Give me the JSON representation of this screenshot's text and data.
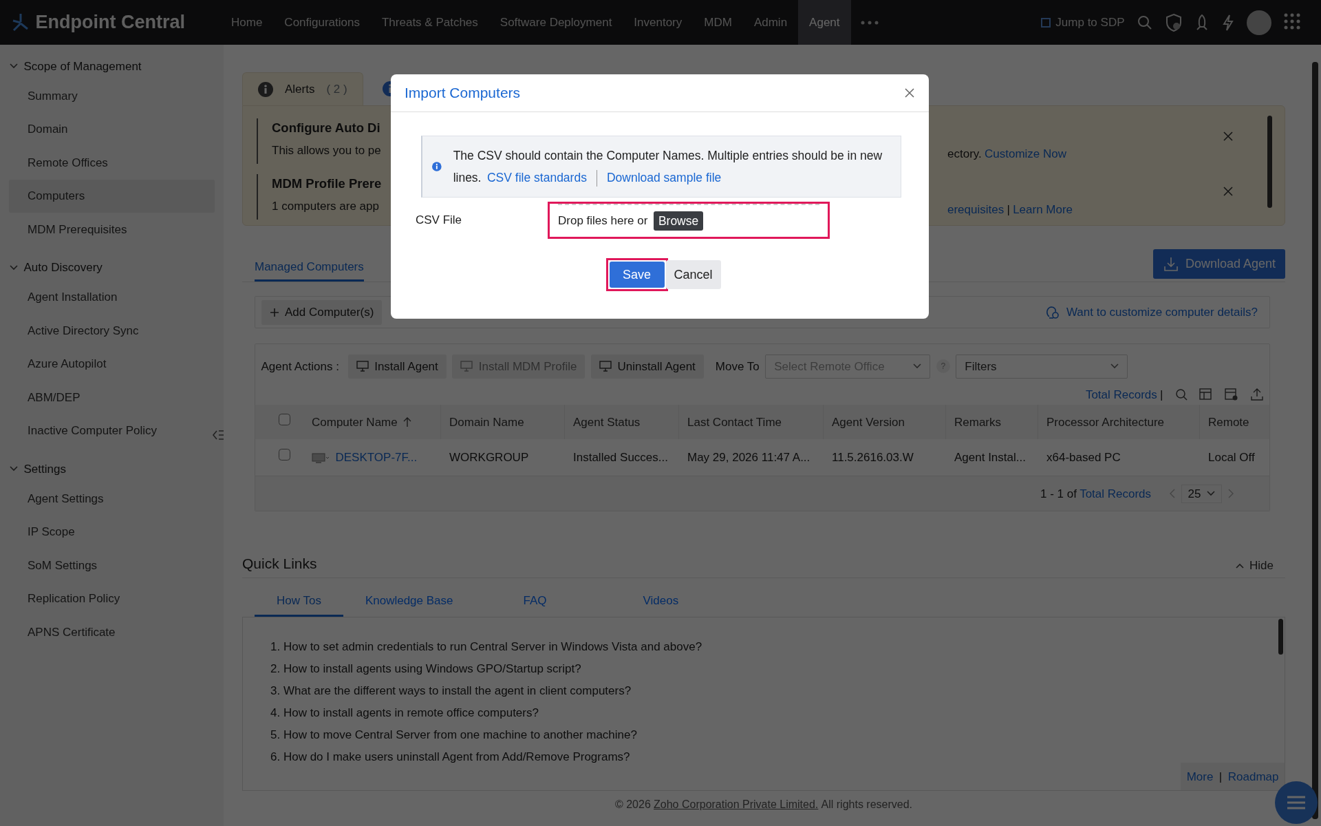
{
  "app": {
    "title": "Endpoint Central"
  },
  "nav": [
    {
      "label": "Home",
      "selected": false
    },
    {
      "label": "Configurations",
      "selected": false
    },
    {
      "label": "Threats & Patches",
      "selected": false
    },
    {
      "label": "Software Deployment",
      "selected": false
    },
    {
      "label": "Inventory",
      "selected": false
    },
    {
      "label": "MDM",
      "selected": false
    },
    {
      "label": "Admin",
      "selected": false
    },
    {
      "label": "Agent",
      "selected": true
    }
  ],
  "jump": "Jump to SDP",
  "sidebar": [
    {
      "label": "Scope of Management",
      "expanded": true,
      "children": [
        {
          "label": "Summary",
          "selected": false
        },
        {
          "label": "Domain",
          "selected": false
        },
        {
          "label": "Remote Offices",
          "selected": false
        },
        {
          "label": "Computers",
          "selected": true
        },
        {
          "label": "MDM Prerequisites",
          "selected": false
        }
      ]
    },
    {
      "label": "Auto Discovery",
      "expanded": true,
      "children": [
        {
          "label": "Agent Installation",
          "selected": false
        },
        {
          "label": "Active Directory Sync",
          "selected": false
        },
        {
          "label": "Azure Autopilot",
          "selected": false
        },
        {
          "label": "ABM/DEP",
          "selected": false
        },
        {
          "label": "Inactive Computer Policy",
          "selected": false
        }
      ]
    },
    {
      "label": "Settings",
      "expanded": true,
      "children": [
        {
          "label": "Agent Settings",
          "selected": false
        },
        {
          "label": "IP Scope",
          "selected": false
        },
        {
          "label": "SoM Settings",
          "selected": false
        },
        {
          "label": "Replication Policy",
          "selected": false
        },
        {
          "label": "APNS Certificate",
          "selected": false
        }
      ]
    }
  ],
  "alert_tabs": [
    {
      "label": "Alerts",
      "count": "( 2 )",
      "selected": true
    }
  ],
  "alerts": [
    {
      "title": "Configure Auto Di",
      "text": "This allows you to pe",
      "tail": "ectory.",
      "links": [
        "Customize Now"
      ]
    },
    {
      "title": "MDM Profile Prere",
      "text": "1 computers are app",
      "links": [
        "erequisites",
        "Learn More"
      ],
      "separator": "|"
    }
  ],
  "content_tabs": [
    {
      "label": "Managed Computers",
      "selected": true
    }
  ],
  "download_button": "Download Agent",
  "add_button": "Add Computer(s)",
  "customize_link": "Want to customize computer details?",
  "agent_actions": {
    "label": "Agent Actions :",
    "buttons": [
      {
        "label": "Install Agent",
        "disabled": false
      },
      {
        "label": "Install MDM Profile",
        "disabled": true
      },
      {
        "label": "Uninstall Agent",
        "disabled": false
      }
    ],
    "move_to": "Move To",
    "remote_office": {
      "placeholder": "Select Remote Office"
    },
    "help": "?",
    "filters": "Filters"
  },
  "total_records_link": "Total Records",
  "total_records_separator": "|",
  "table": {
    "select_all_checked": false,
    "columns": [
      "Computer Name",
      "Domain Name",
      "Agent Status",
      "Last Contact Time",
      "Agent Version",
      "Remarks",
      "Processor Architecture",
      "Remote"
    ],
    "rows": [
      {
        "checked": false,
        "cells": [
          "DESKTOP-7F...",
          "WORKGROUP",
          "Installed Succes...",
          "May 29, 2026 11:47 A...",
          "11.5.2616.03.W",
          "Agent Instal...",
          "x64-based PC",
          "Local Off"
        ]
      }
    ]
  },
  "pagination": {
    "range": "1 - 1 of",
    "link": "Total Records",
    "page_size": "25"
  },
  "quick_links": {
    "title": "Quick Links",
    "hide": "Hide",
    "tabs": [
      {
        "label": "How Tos",
        "selected": true
      },
      {
        "label": "Knowledge Base",
        "selected": false
      },
      {
        "label": "FAQ",
        "selected": false
      },
      {
        "label": "Videos",
        "selected": false
      }
    ],
    "items": [
      "1. How to set admin credentials to run Central Server in Windows Vista and above?",
      "2. How to install agents using Windows GPO/Startup script?",
      "3. What are the different ways to install the agent in client computers?",
      "4. How to install agents in remote office computers?",
      "5. How to move Central Server from one machine to another machine?",
      "6. How do I make users uninstall Agent from Add/Remove Programs?"
    ],
    "more": "More",
    "separator": "|",
    "roadmap": "Roadmap"
  },
  "footer": {
    "prefix": "© 2026",
    "company": "Zoho Corporation Private Limited.",
    "suffix": "All rights reserved."
  },
  "modal": {
    "title": "Import Computers",
    "info": "The CSV should contain the Computer Names. Multiple entries should be in new lines.",
    "info_links": [
      "CSV file standards",
      "Download sample file"
    ],
    "field_label": "CSV File",
    "dropzone": {
      "text": "Drop files here or",
      "button": "Browse",
      "highlighted": true
    },
    "buttons": [
      {
        "label": "Save",
        "kind": "primary",
        "highlighted": true
      },
      {
        "label": "Cancel",
        "kind": "secondary",
        "highlighted": false
      }
    ]
  }
}
